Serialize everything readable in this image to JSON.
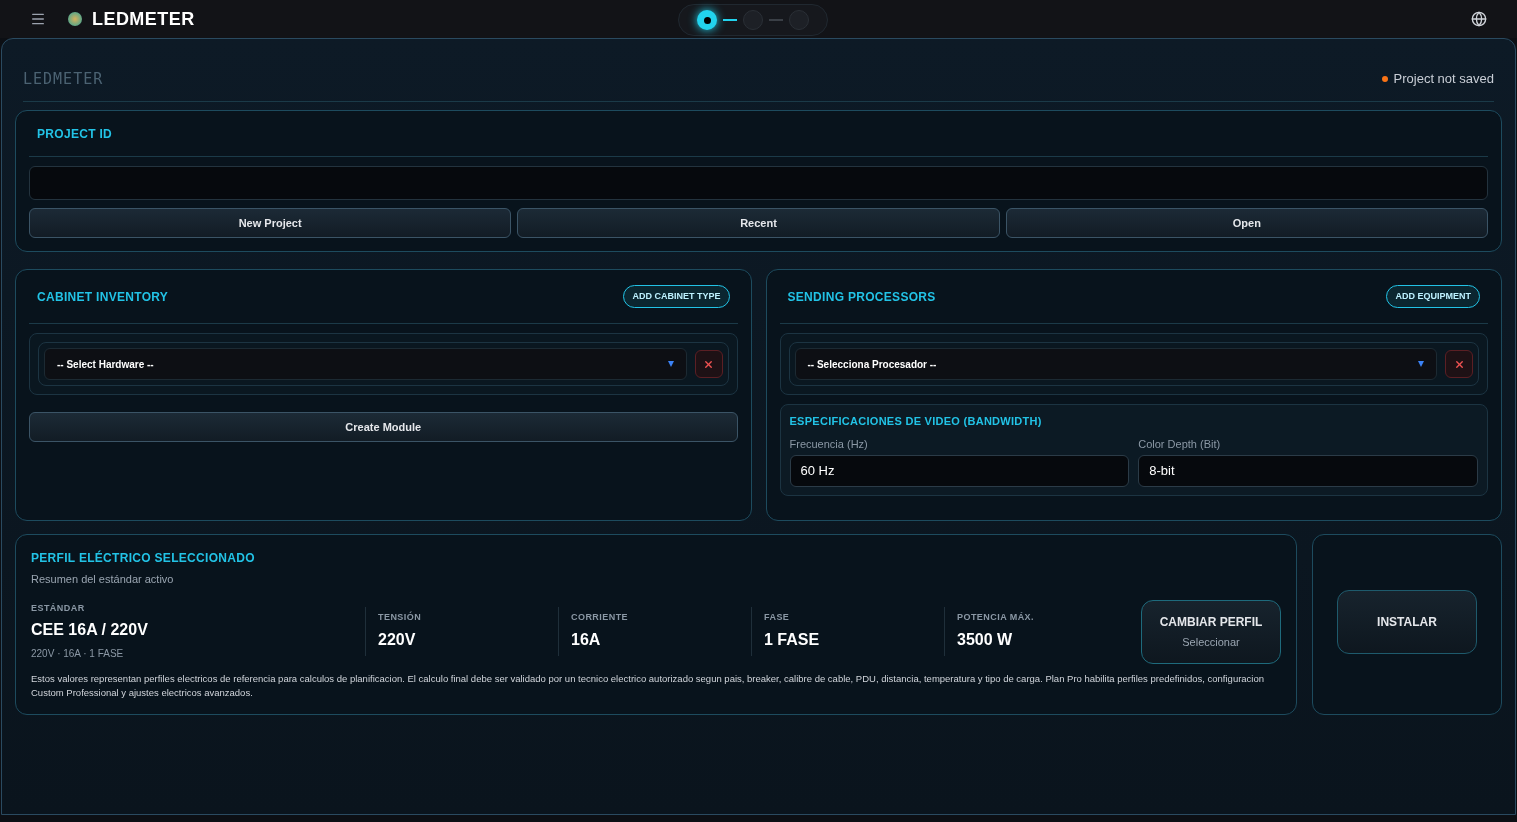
{
  "app_bar": {
    "title": "LEDMETER",
    "steps": [
      {
        "selected": true
      },
      {
        "selected": false
      },
      {
        "selected": false
      }
    ]
  },
  "header": {
    "logo_text": "LEDMETER",
    "status": "Project not saved",
    "saved": false
  },
  "project": {
    "title": "PROJECT ID",
    "buttons": [
      "New Project",
      "Recent",
      "Open"
    ]
  },
  "cabinet_inventory": {
    "title": "CABINET INVENTORY",
    "add_button": "ADD CABINET TYPE",
    "select": "-- Select Hardware --",
    "create_button": "Create Module"
  },
  "sending_processors": {
    "title": "SENDING PROCESSORS",
    "add_button": "ADD EQUIPMENT",
    "select": "-- Selecciona Procesador --",
    "video_specs": {
      "title": "ESPECIFICACIONES DE VIDEO (BANDWIDTH)",
      "fields": [
        {
          "label": "Frecuencia (Hz)",
          "value": "60 Hz"
        },
        {
          "label": "Color Depth (Bit)",
          "value": "8-bit"
        }
      ]
    }
  },
  "electrical_profile": {
    "title": "PERFIL ELÉCTRICO SELECCIONADO",
    "subtitle": "Resumen del estándar activo",
    "standard": {
      "label": "ESTÁNDAR",
      "value": "CEE 16A / 220V",
      "detail": "220V · 16A · 1 FASE"
    },
    "stats": [
      {
        "label": "TENSIÓN",
        "value": "220V"
      },
      {
        "label": "CORRIENTE",
        "value": "16A"
      },
      {
        "label": "FASE",
        "value": "1 FASE"
      },
      {
        "label": "POTENCIA MÁX.",
        "value": "3500 W"
      }
    ],
    "change_button": {
      "title": "CAMBIAR PERFIL",
      "subtitle": "Seleccionar"
    },
    "note": "Estos valores representan perfiles electricos de referencia para calculos de planificacion. El calculo final debe ser validado por un tecnico electrico autorizado segun pais, breaker, calibre de cable, PDU, distancia, temperatura y tipo de carga. Plan Pro habilita perfiles predefinidos, configuracion Custom Professional y ajustes electricos avanzados."
  },
  "install_button": "INSTALAR"
}
